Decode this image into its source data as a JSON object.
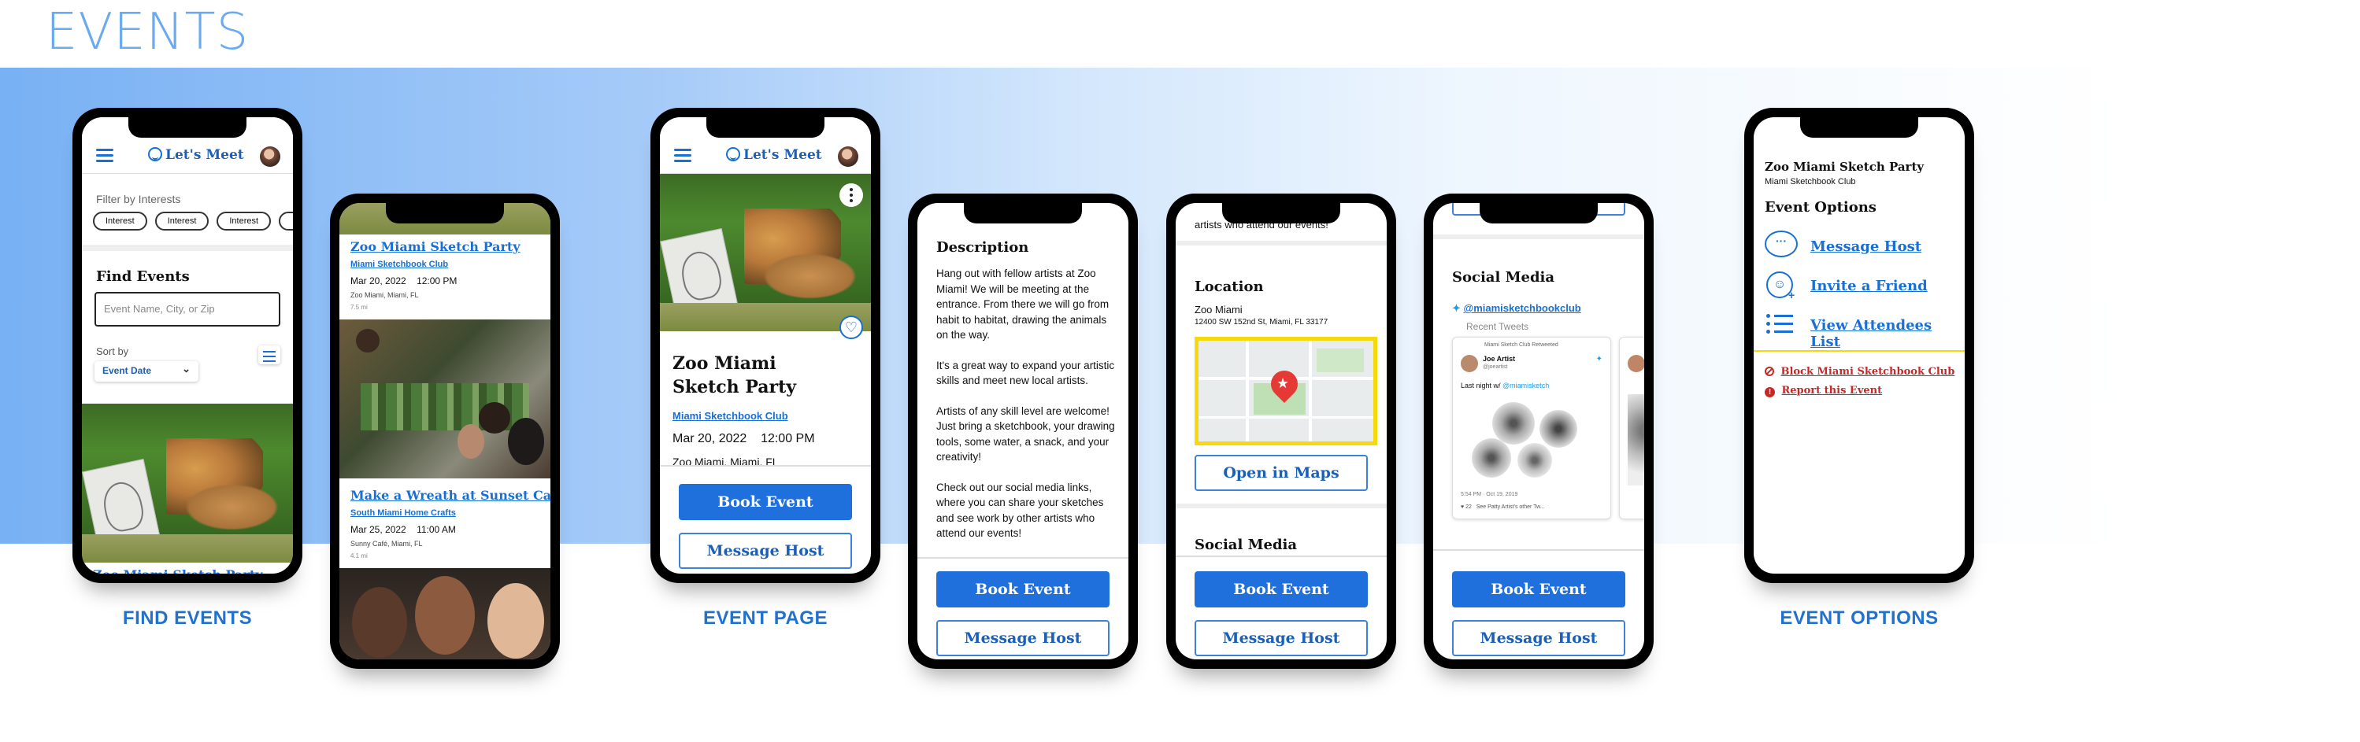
{
  "page_title": "EVENTS",
  "captions": {
    "find_events": "FIND EVENTS",
    "event_page": "EVENT PAGE",
    "event_options": "EVENT OPTIONS"
  },
  "app": {
    "logo": "Let's Meet"
  },
  "find": {
    "filter_label": "Filter by Interests",
    "chips": [
      "Interest",
      "Interest",
      "Interest"
    ],
    "heading": "Find Events",
    "search_placeholder": "Event Name, City, or Zip",
    "sort_label": "Sort by",
    "sort_value": "Event Date",
    "peek_title": "Zoo Miami Sketch Party"
  },
  "events": [
    {
      "title": "Zoo Miami Sketch Party",
      "host": "Miami Sketchbook Club",
      "date": "Mar 20, 2022",
      "time": "12:00 PM",
      "place": "Zoo Miami, Miami, FL",
      "distance": "7.5 mi"
    },
    {
      "title": "Make a Wreath at Sunset Café",
      "host": "South Miami Home Crafts",
      "date": "Mar 25, 2022",
      "time": "11:00 AM",
      "place": "Sunny Café, Miami, FL",
      "distance": "4.1 mi"
    }
  ],
  "event": {
    "title": "Zoo Miami Sketch Party",
    "host": "Miami Sketchbook Club",
    "date": "Mar 20, 2022",
    "time": "12:00 PM",
    "place_cut": "Zoo Miami, Miami, FL",
    "book": "Book Event",
    "message": "Message Host"
  },
  "description": {
    "heading": "Description",
    "paragraphs": [
      "Hang out with fellow artists at Zoo Miami! We will be meeting at the entrance. From there we will go from habit to habitat, drawing the animals on the way.",
      "It's a great way to expand your artistic skills and meet new local artists.",
      "Artists of any skill level are welcome! Just bring a sketchbook, your drawing tools, some water, a snack, and your creativity!",
      "Check out our social media links, where you can share your sketches and see work by other artists who attend our events!"
    ],
    "top_cut": "artists who attend our events!"
  },
  "location": {
    "heading": "Location",
    "name": "Zoo Miami",
    "address": "12400 SW 152nd St, Miami, FL 33177",
    "open_maps": "Open in Maps",
    "next_heading": "Social Media"
  },
  "social": {
    "heading": "Social Media",
    "handle": "@miamisketchbookclub",
    "recent": "Recent Tweets",
    "tweet": {
      "retweeted": "Miami Sketch Club Retweeted",
      "name": "Joe Artist",
      "user": "@joeartist",
      "text": "Last night w/",
      "mention": "@miamisketch",
      "meta": "5:54 PM · Oct 19, 2019",
      "likes": "22",
      "see_more": "See Patty Artist's other Tw..."
    }
  },
  "options": {
    "event_title": "Zoo Miami Sketch Party",
    "host": "Miami Sketchbook Club",
    "heading": "Event Options",
    "items": [
      "Message Host",
      "Invite a Friend",
      "View Attendees List"
    ],
    "danger": [
      "Block Miami Sketchbook Club",
      "Report this Event"
    ]
  },
  "colors": {
    "primary": "#1f6fdc",
    "link": "#1a6fd2",
    "danger": "#c62828",
    "highlight": "#f5d90a"
  }
}
